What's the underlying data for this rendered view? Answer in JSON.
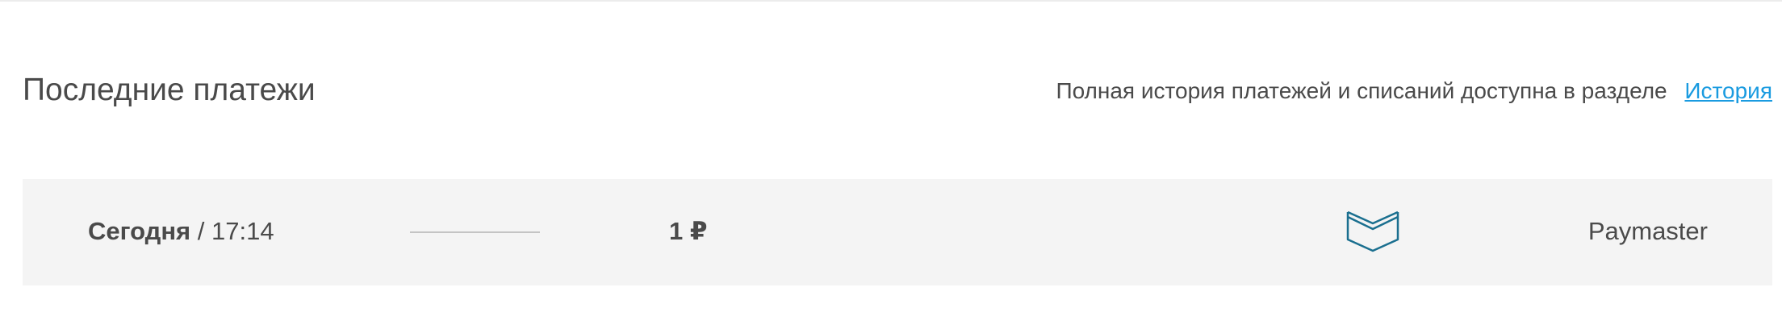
{
  "header": {
    "title": "Последние платежи",
    "history_note": "Полная история платежей и списаний доступна в разделе",
    "history_link": "История"
  },
  "payments": [
    {
      "date": "Сегодня",
      "separator": "/",
      "time": "17:14",
      "amount": "1 ₽",
      "method_icon": "wallet-icon",
      "method": "Paymaster"
    }
  ],
  "colors": {
    "text": "#4a4a4a",
    "link": "#1a9be0",
    "row_background": "#f4f4f4",
    "icon": "#1a6f8f"
  }
}
